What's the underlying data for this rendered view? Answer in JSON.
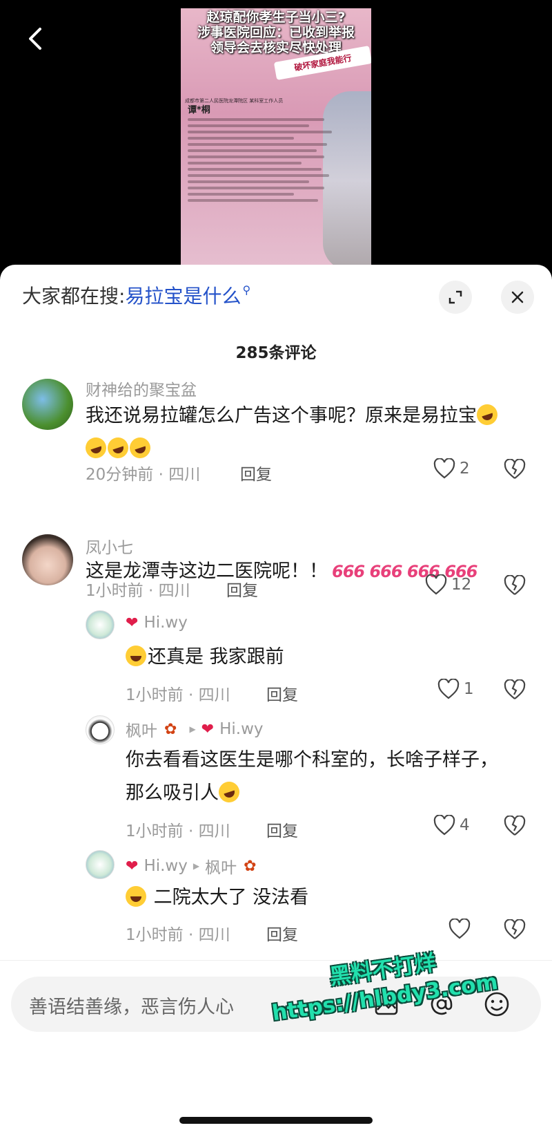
{
  "video": {
    "headline_lines": [
      "赵琼配你孝生子当小三?",
      "涉事医院回应：已收到举报",
      "领导会去核实尽快处理"
    ],
    "sign_text": "破坏家庭我能行",
    "doc_header": "成都市第二人民医院龙潭院区 某科室工作人员",
    "doc_name": "谭*桐"
  },
  "search": {
    "prefix": "大家都在搜:",
    "term": "易拉宝是什么"
  },
  "comment_count": "285条评论",
  "comments": [
    {
      "user": "财神给的聚宝盆",
      "text": "我还说易拉罐怎么广告这个事呢？原来是易拉宝",
      "time": "20分钟前 · 四川",
      "reply": "回复",
      "likes": "2"
    },
    {
      "user": "凤小七",
      "text": "这是龙潭寺这边二医院呢！！",
      "badge": "666 666 666 666",
      "time": "1小时前 · 四川",
      "reply": "回复",
      "likes": "12"
    }
  ],
  "replies": [
    {
      "user": "Hi.wy",
      "text": "还真是 我家跟前",
      "time": "1小时前 · 四川",
      "reply": "回复",
      "likes": "1"
    },
    {
      "user": "枫叶",
      "to": "Hi.wy",
      "text": "你去看看这医生是哪个科室的，长啥子样子，那么吸引人",
      "time": "1小时前 · 四川",
      "reply": "回复",
      "likes": "4"
    },
    {
      "user": "Hi.wy",
      "to": "枫叶",
      "text": "二院太大了 没法看",
      "time": "1小时前 · 四川",
      "reply": "回复",
      "likes": ""
    }
  ],
  "input": {
    "placeholder": "善语结善缘，恶言伤人心"
  },
  "watermark": {
    "line1": "黑料不打烊",
    "line2": "https://hlbdy3.com"
  },
  "colors": {
    "accent_blue": "#2452c9",
    "watermark": "#22e0ad"
  }
}
